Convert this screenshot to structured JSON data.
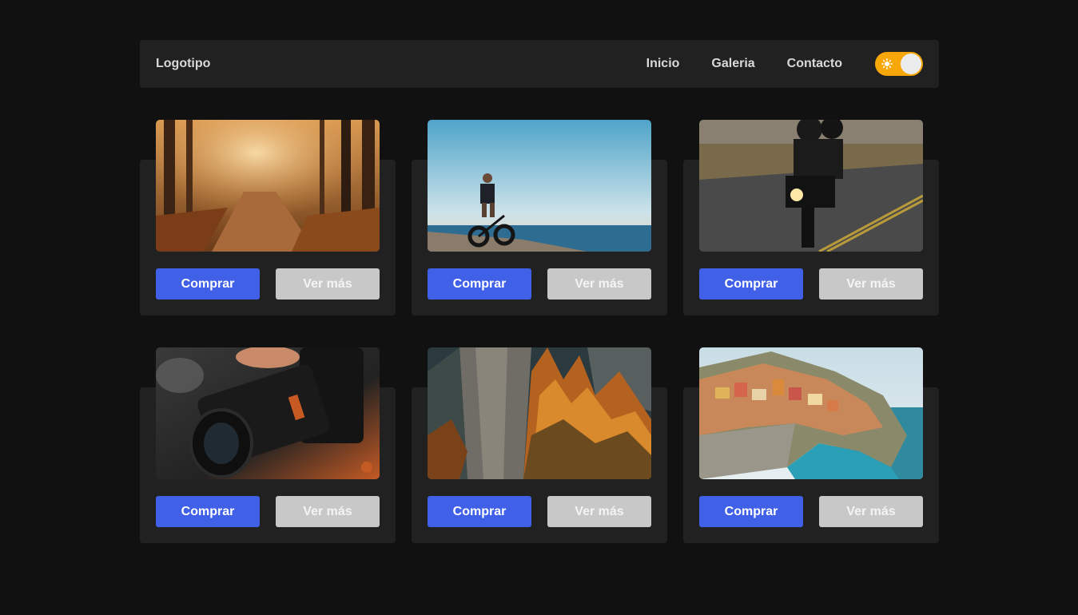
{
  "navbar": {
    "logo": "Logotipo",
    "links": [
      "Inicio",
      "Galeria",
      "Contacto"
    ],
    "theme_toggle_icon": "sun-icon",
    "accent": "#f7a708"
  },
  "cards": [
    {
      "image": "forest-path-sunlight",
      "buy_label": "Comprar",
      "more_label": "Ver más"
    },
    {
      "image": "cyclist-on-beach",
      "buy_label": "Comprar",
      "more_label": "Ver más"
    },
    {
      "image": "motorcycle-riders-road",
      "buy_label": "Comprar",
      "more_label": "Ver más"
    },
    {
      "image": "camera-with-lens",
      "buy_label": "Comprar",
      "more_label": "Ver más"
    },
    {
      "image": "autumn-cliff-trees",
      "buy_label": "Comprar",
      "more_label": "Ver más"
    },
    {
      "image": "coastal-cliff-village",
      "buy_label": "Comprar",
      "more_label": "Ver más"
    }
  ],
  "colors": {
    "background": "#111111",
    "surface": "#212121",
    "primary_button": "#4060e8",
    "secondary_button": "#c8c8c8"
  }
}
